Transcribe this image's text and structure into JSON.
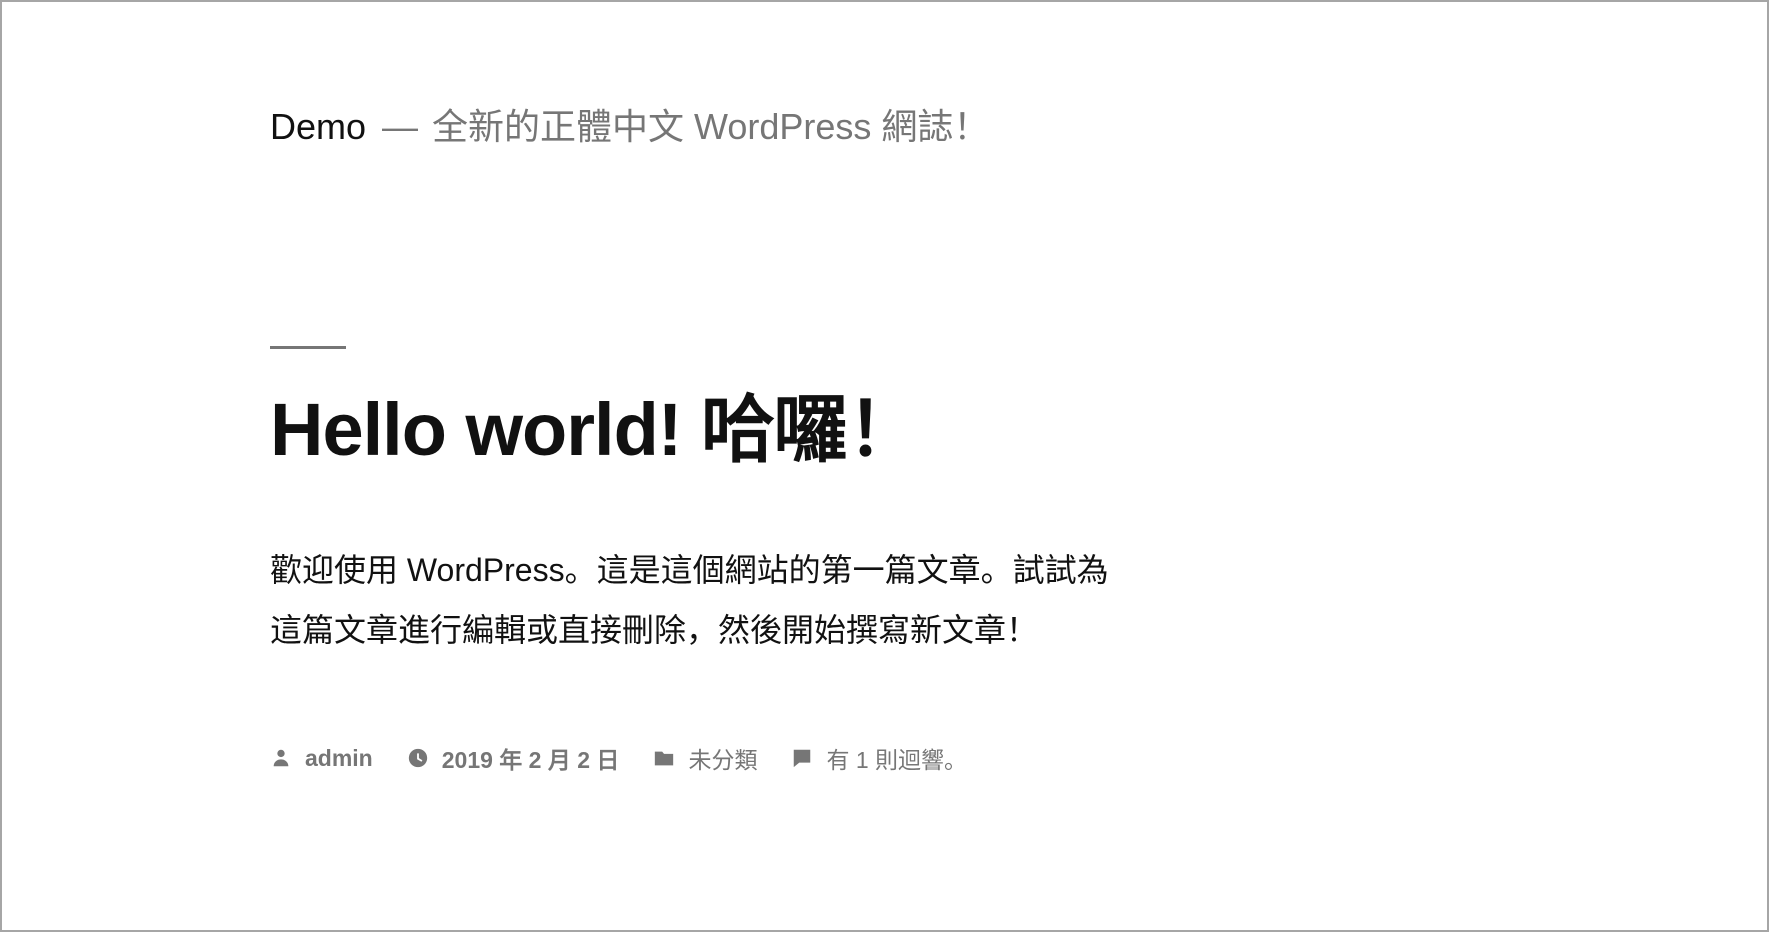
{
  "header": {
    "site_title": "Demo",
    "separator": "—",
    "tagline": "全新的正體中文 WordPress 網誌！"
  },
  "post": {
    "title": "Hello world! 哈囉！",
    "content": "歡迎使用 WordPress。這是這個網站的第一篇文章。試試為這篇文章進行編輯或直接刪除，然後開始撰寫新文章！",
    "meta": {
      "author": "admin",
      "date": "2019 年 2 月 2 日",
      "category": "未分類",
      "comments": "有 1 則迴響。"
    }
  },
  "icons": {
    "author": "person-icon",
    "date": "clock-icon",
    "category": "folder-icon",
    "comments": "comment-icon"
  },
  "colors": {
    "text": "#111111",
    "meta": "#767676",
    "frame_border": "#a6a6a6",
    "background": "#ffffff"
  }
}
